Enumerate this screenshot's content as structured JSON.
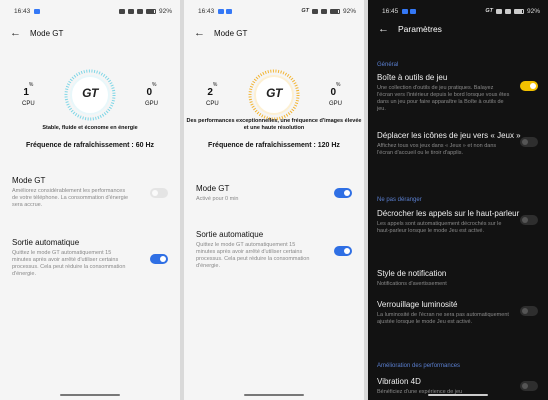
{
  "status_left": {
    "time": "16:43",
    "battery": "92%"
  },
  "status_mid": {
    "time": "16:43",
    "battery": "92%",
    "badge": "GT"
  },
  "status_right": {
    "time": "16:45",
    "battery": "92%",
    "badge": "GT"
  },
  "screen1": {
    "title": "Mode GT",
    "cpu": {
      "value": "1",
      "unit": "%",
      "label": "CPU"
    },
    "gpu": {
      "value": "0",
      "unit": "%",
      "label": "GPU"
    },
    "logo": "GT",
    "tagline": "Stable, fluide et économe en énergie",
    "refresh": "Fréquence de rafraîchissement : 60 Hz",
    "mode_gt": {
      "title": "Mode GT",
      "desc": "Améliorez considérablement les performances de votre téléphone. La consommation d'énergie sera accrue.",
      "on": false
    },
    "auto_exit": {
      "title": "Sortie automatique",
      "desc": "Quittez le mode GT automatiquement 15 minutes après avoir arrêté d'utiliser certains processus. Cela peut réduire la consommation d'énergie.",
      "on": true
    }
  },
  "screen2": {
    "title": "Mode GT",
    "cpu": {
      "value": "2",
      "unit": "%",
      "label": "CPU"
    },
    "gpu": {
      "value": "0",
      "unit": "%",
      "label": "GPU"
    },
    "logo": "GT",
    "tagline": "Des performances exceptionnelles, une fréquence d'images élevée et une haute résolution",
    "refresh": "Fréquence de rafraîchissement : 120 Hz",
    "mode_gt": {
      "title": "Mode GT",
      "desc": "Activé pour 0 min",
      "on": true
    },
    "auto_exit": {
      "title": "Sortie automatique",
      "desc": "Quittez le mode GT automatiquement 15 minutes après avoir arrêté d'utiliser certains processus. Cela peut réduire la consommation d'énergie.",
      "on": true
    }
  },
  "screen3": {
    "title": "Paramètres",
    "section_general": "Général",
    "toolbox": {
      "title": "Boîte à outils de jeu",
      "desc": "Une collection d'outils de jeu pratiques. Balayez l'écran vers l'intérieur depuis le bord lorsque vous êtes dans un jeu pour faire apparaître la Boîte à outils de jeu.",
      "on": true
    },
    "move_icons": {
      "title": "Déplacer les icônes de jeu vers « Jeux »",
      "desc": "Affichez tous vos jeux dans « Jeux » et non dans l'écran d'accueil ou le tiroir d'applis.",
      "on": false
    },
    "section_dnd": "Ne pas déranger",
    "speaker": {
      "title": "Décrocher les appels sur le haut-parleur",
      "desc": "Les appels sont automatiquement décrochés sur le haut-parleur lorsque le mode Jeu est activé.",
      "on": false
    },
    "notif_style": {
      "title": "Style de notification",
      "desc": "Notifications d'avertissement"
    },
    "brightness_lock": {
      "title": "Verrouillage luminosité",
      "desc": "La luminosité de l'écran ne sera pas automatiquement ajustée lorsque le mode Jeu est activé.",
      "on": false
    },
    "section_perf": "Amélioration des performances",
    "vibration": {
      "title": "Vibration 4D",
      "desc": "Bénéficiez d'une expérience de jeu",
      "on": false
    }
  }
}
